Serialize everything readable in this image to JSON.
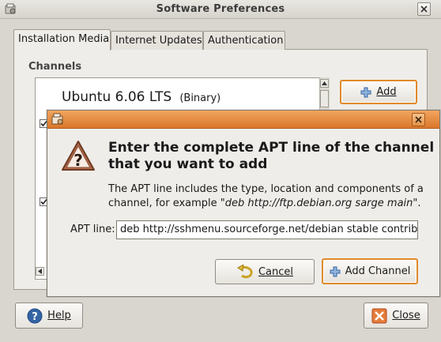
{
  "window": {
    "title": "Software Preferences",
    "icon": "software-properties-icon",
    "close_icon": "close-icon"
  },
  "tabs": [
    {
      "label": "Installation Media",
      "active": true
    },
    {
      "label": "Internet Updates",
      "active": false
    },
    {
      "label": "Authentication",
      "active": false
    }
  ],
  "channels": {
    "section_label": "Channels",
    "items": [
      {
        "name": "Ubuntu 6.06 LTS",
        "type": "(Binary)"
      }
    ],
    "checkboxes_checked": [
      true,
      true
    ]
  },
  "buttons": {
    "add_label": "Add",
    "help_label": "Help",
    "close_label": "Close"
  },
  "dialog": {
    "heading_line1": "Enter the complete APT line of the channel",
    "heading_line2": "that you want to add",
    "desc_line1": "The APT line includes the type, location and components of a",
    "desc_line2_prefix": "channel, for example \"",
    "desc_line2_example": "deb http://ftp.debian.org sarge main",
    "desc_line2_suffix": "\".",
    "apt_label": "APT line:",
    "apt_value": "deb http://sshmenu.sourceforge.net/debian stable contrib",
    "cancel_label": "Cancel",
    "add_channel_label": "Add Channel"
  },
  "colors": {
    "accent_orange": "#e08a2b",
    "dialog_title_orange": "#d9772c",
    "help_blue": "#3465a4",
    "close_red": "#d9534f"
  }
}
